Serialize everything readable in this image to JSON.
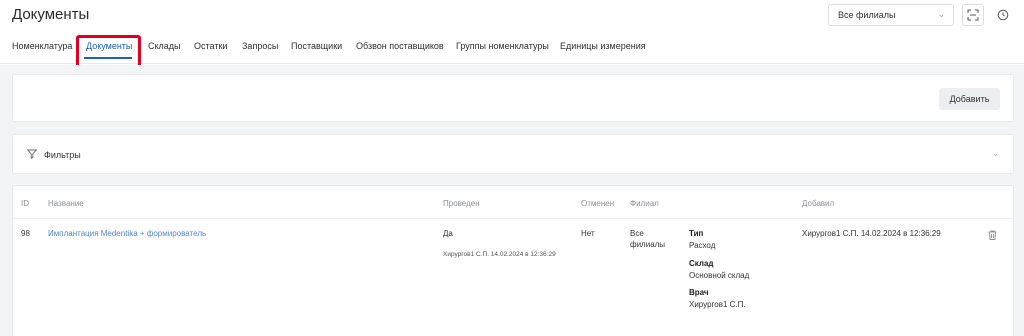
{
  "header": {
    "title": "Документы",
    "branch_select": "Все филиалы"
  },
  "tabs": [
    {
      "label": "Номенклатура"
    },
    {
      "label": "Документы"
    },
    {
      "label": "Склады"
    },
    {
      "label": "Остатки"
    },
    {
      "label": "Запросы"
    },
    {
      "label": "Поставщики"
    },
    {
      "label": "Обзвон поставщиков"
    },
    {
      "label": "Группы номенклатуры"
    },
    {
      "label": "Единицы измерения"
    }
  ],
  "toolbar": {
    "add_label": "Добавить"
  },
  "filters": {
    "label": "Фильтры"
  },
  "table": {
    "columns": [
      "ID",
      "Название",
      "Проведен",
      "Отменен",
      "Филиал",
      "Добавил"
    ],
    "rows": [
      {
        "id": "98",
        "name": "Имплантация Medentika + формирователь",
        "posted": "Да",
        "posted_by": "Хирургов1 С.П. 14.02.2024 в 12:36:29",
        "cancelled": "Нет",
        "branch": "Все филиалы",
        "type_label": "Тип",
        "type_value": "Расход",
        "warehouse_label": "Склад",
        "warehouse_value": "Основной склад",
        "doctor_label": "Врач",
        "doctor_value": "Хирургов1 С.П.",
        "added_by": "Хирургов1 С.П. 14.02.2024 в 12:36:29"
      }
    ]
  },
  "colors": {
    "accent": "#1f5fbf",
    "link": "#4f86d6",
    "highlight": "#e4001c",
    "background": "#f3f4f6"
  }
}
